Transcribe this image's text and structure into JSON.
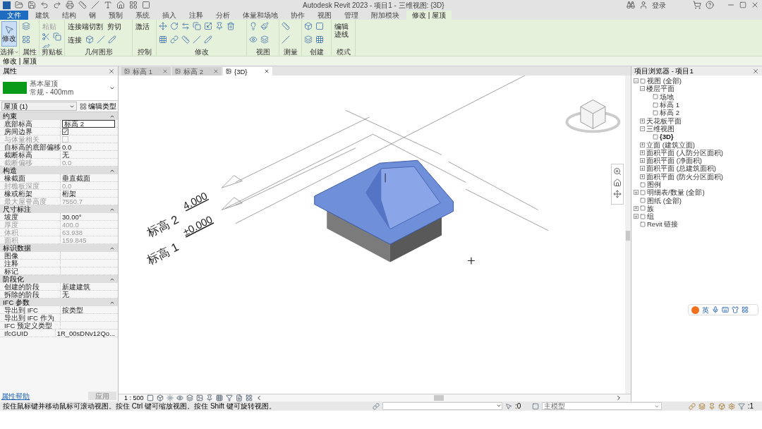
{
  "title_bar": {
    "title": "Autodesk Revit 2023 - 项目1 - 三维视图: {3D}",
    "user": "登录"
  },
  "ribbon_tabs": [
    {
      "label": "文件",
      "kind": "file",
      "selected": false
    },
    {
      "label": "建筑",
      "kind": "tab",
      "selected": false
    },
    {
      "label": "结构",
      "kind": "tab",
      "selected": false
    },
    {
      "label": "钢",
      "kind": "tab",
      "selected": false
    },
    {
      "label": "预制",
      "kind": "tab",
      "selected": false
    },
    {
      "label": "系统",
      "kind": "tab",
      "selected": false
    },
    {
      "label": "插入",
      "kind": "tab",
      "selected": false
    },
    {
      "label": "注释",
      "kind": "tab",
      "selected": false
    },
    {
      "label": "分析",
      "kind": "tab",
      "selected": false
    },
    {
      "label": "体量和场地",
      "kind": "tab",
      "selected": false
    },
    {
      "label": "协作",
      "kind": "tab",
      "selected": false
    },
    {
      "label": "视图",
      "kind": "tab",
      "selected": false
    },
    {
      "label": "管理",
      "kind": "tab",
      "selected": false
    },
    {
      "label": "附加模块",
      "kind": "tab",
      "selected": false
    },
    {
      "label": "修改 | 屋顶",
      "kind": "tab",
      "selected": true
    }
  ],
  "ribbon_panels": [
    {
      "label": "选择",
      "tools": [
        {
          "label": "修改",
          "selected": true,
          "disabled": false
        }
      ]
    },
    {
      "label": "属性"
    },
    {
      "label": "剪贴板",
      "tools": [
        {
          "label": "粘贴",
          "selected": false,
          "disabled": true
        }
      ]
    },
    {
      "label": "几何图形",
      "tools": [
        {
          "label": "连接端切割",
          "selected": false,
          "disabled": false
        },
        {
          "label": "剪切",
          "selected": false,
          "disabled": false
        },
        {
          "label": "连接",
          "selected": false,
          "disabled": false
        }
      ]
    },
    {
      "label": "控制",
      "tools": [
        {
          "label": "激活",
          "selected": false,
          "disabled": false
        }
      ]
    },
    {
      "label": "修改"
    },
    {
      "label": "视图"
    },
    {
      "label": "测量"
    },
    {
      "label": "创建"
    },
    {
      "label": "模式",
      "tools": [
        {
          "label": "编辑迹线",
          "selected": false,
          "disabled": false
        }
      ]
    }
  ],
  "context_bar": "修改 | 屋顶",
  "properties": {
    "title": "属性",
    "type_family": "基本屋顶",
    "type_name": "常规 - 400mm",
    "instance_filter": "屋顶 (1)",
    "edit_type": "编辑类型",
    "sections": [
      {
        "title": "约束",
        "rows": [
          {
            "label": "底部标高",
            "value": "标高 2",
            "kind": "field",
            "disabled": false
          },
          {
            "label": "房间边界",
            "kind": "checkbox",
            "checked": true,
            "disabled": false
          },
          {
            "label": "与体量相关",
            "kind": "checkbox",
            "checked": false,
            "disabled": true
          },
          {
            "label": "自标高的底部偏移",
            "value": "0.0",
            "kind": "text",
            "disabled": false
          },
          {
            "label": "截断标高",
            "value": "无",
            "kind": "text",
            "disabled": false
          },
          {
            "label": "截断偏移",
            "value": "0.0",
            "kind": "text",
            "disabled": true
          }
        ]
      },
      {
        "title": "构造",
        "rows": [
          {
            "label": "椽截面",
            "value": "垂直截面",
            "kind": "text",
            "disabled": false
          },
          {
            "label": "封檐板深度",
            "value": "0.0",
            "kind": "text",
            "disabled": true
          },
          {
            "label": "椽或桁架",
            "value": "桁架",
            "kind": "text",
            "disabled": false
          },
          {
            "label": "最大屋脊高度",
            "value": "7550.7",
            "kind": "text",
            "disabled": true
          }
        ]
      },
      {
        "title": "尺寸标注",
        "rows": [
          {
            "label": "坡度",
            "value": "30.00°",
            "kind": "text",
            "disabled": false
          },
          {
            "label": "厚度",
            "value": "400.0",
            "kind": "text",
            "disabled": true
          },
          {
            "label": "体积",
            "value": "63.938",
            "kind": "text",
            "disabled": true
          },
          {
            "label": "面积",
            "value": "159.845",
            "kind": "text",
            "disabled": true
          }
        ]
      },
      {
        "title": "标识数据",
        "rows": [
          {
            "label": "图像",
            "kind": "text",
            "disabled": false
          },
          {
            "label": "注释",
            "kind": "text",
            "disabled": false
          },
          {
            "label": "标记",
            "kind": "text",
            "disabled": false
          }
        ]
      },
      {
        "title": "阶段化",
        "rows": [
          {
            "label": "创建的阶段",
            "value": "新建建筑",
            "kind": "text",
            "disabled": false
          },
          {
            "label": "拆除的阶段",
            "value": "无",
            "kind": "text",
            "disabled": false
          }
        ]
      },
      {
        "title": "IFC 参数",
        "rows": [
          {
            "label": "导出到 IFC",
            "value": "按类型",
            "kind": "text",
            "disabled": false
          },
          {
            "label": "导出到 IFC 作为",
            "kind": "text",
            "disabled": false
          },
          {
            "label": "IFC 预定义类型",
            "kind": "text",
            "disabled": false
          },
          {
            "label": "IfcGUID",
            "value": "1R_00sDNv12Qo...",
            "kind": "text",
            "disabled": false
          }
        ]
      }
    ],
    "help_link": "属性帮助",
    "apply_button": {
      "label": "应用",
      "disabled": true
    }
  },
  "view_tabs": [
    {
      "label": "标高 1",
      "selected": false
    },
    {
      "label": "标高 2",
      "selected": false
    },
    {
      "label": "{3D}",
      "selected": true
    }
  ],
  "levels": [
    {
      "name": "标高 2",
      "elevation": "4.000"
    },
    {
      "name": "标高 1",
      "elevation": "±0.000"
    }
  ],
  "view_scale": "1 : 500",
  "project_browser": {
    "title": "项目浏览器 - 项目1",
    "tree": [
      {
        "label": "视图 (全部)",
        "expanded": true,
        "selected": false,
        "children": [
          {
            "label": "楼层平面",
            "expanded": true,
            "selected": false,
            "children": [
              {
                "label": "场地",
                "selected": false
              },
              {
                "label": "标高 1",
                "selected": false
              },
              {
                "label": "标高 2",
                "selected": false
              }
            ]
          },
          {
            "label": "天花板平面",
            "expanded": false,
            "selected": false
          },
          {
            "label": "三维视图",
            "expanded": true,
            "selected": false,
            "children": [
              {
                "label": "{3D}",
                "selected": true
              }
            ]
          },
          {
            "label": "立面 (建筑立面)",
            "expanded": false,
            "selected": false
          },
          {
            "label": "面积平面 (人防分区面积)",
            "expanded": false,
            "selected": false
          },
          {
            "label": "面积平面 (净面积)",
            "expanded": false,
            "selected": false
          },
          {
            "label": "面积平面 (总建筑面积)",
            "expanded": false,
            "selected": false
          },
          {
            "label": "面积平面 (防火分区面积)",
            "expanded": false,
            "selected": false
          }
        ]
      },
      {
        "label": "图例",
        "selected": false
      },
      {
        "label": "明细表/数量 (全部)",
        "expanded": false,
        "selected": false
      },
      {
        "label": "图纸 (全部)",
        "selected": false
      },
      {
        "label": "族",
        "expanded": false,
        "selected": false
      },
      {
        "label": "组",
        "expanded": false,
        "selected": false
      },
      {
        "label": "Revit 链接",
        "selected": false
      }
    ]
  },
  "ime_bar": {
    "mode": "英"
  },
  "status_bar": {
    "message": "按住鼠标键并移动鼠标可滚动视图。按住 Ctrl 键可缩放视图。按住 Shift 键可旋转视图。",
    "selection_count": ":0",
    "workset": "主模型",
    "filter_count": ":1"
  }
}
